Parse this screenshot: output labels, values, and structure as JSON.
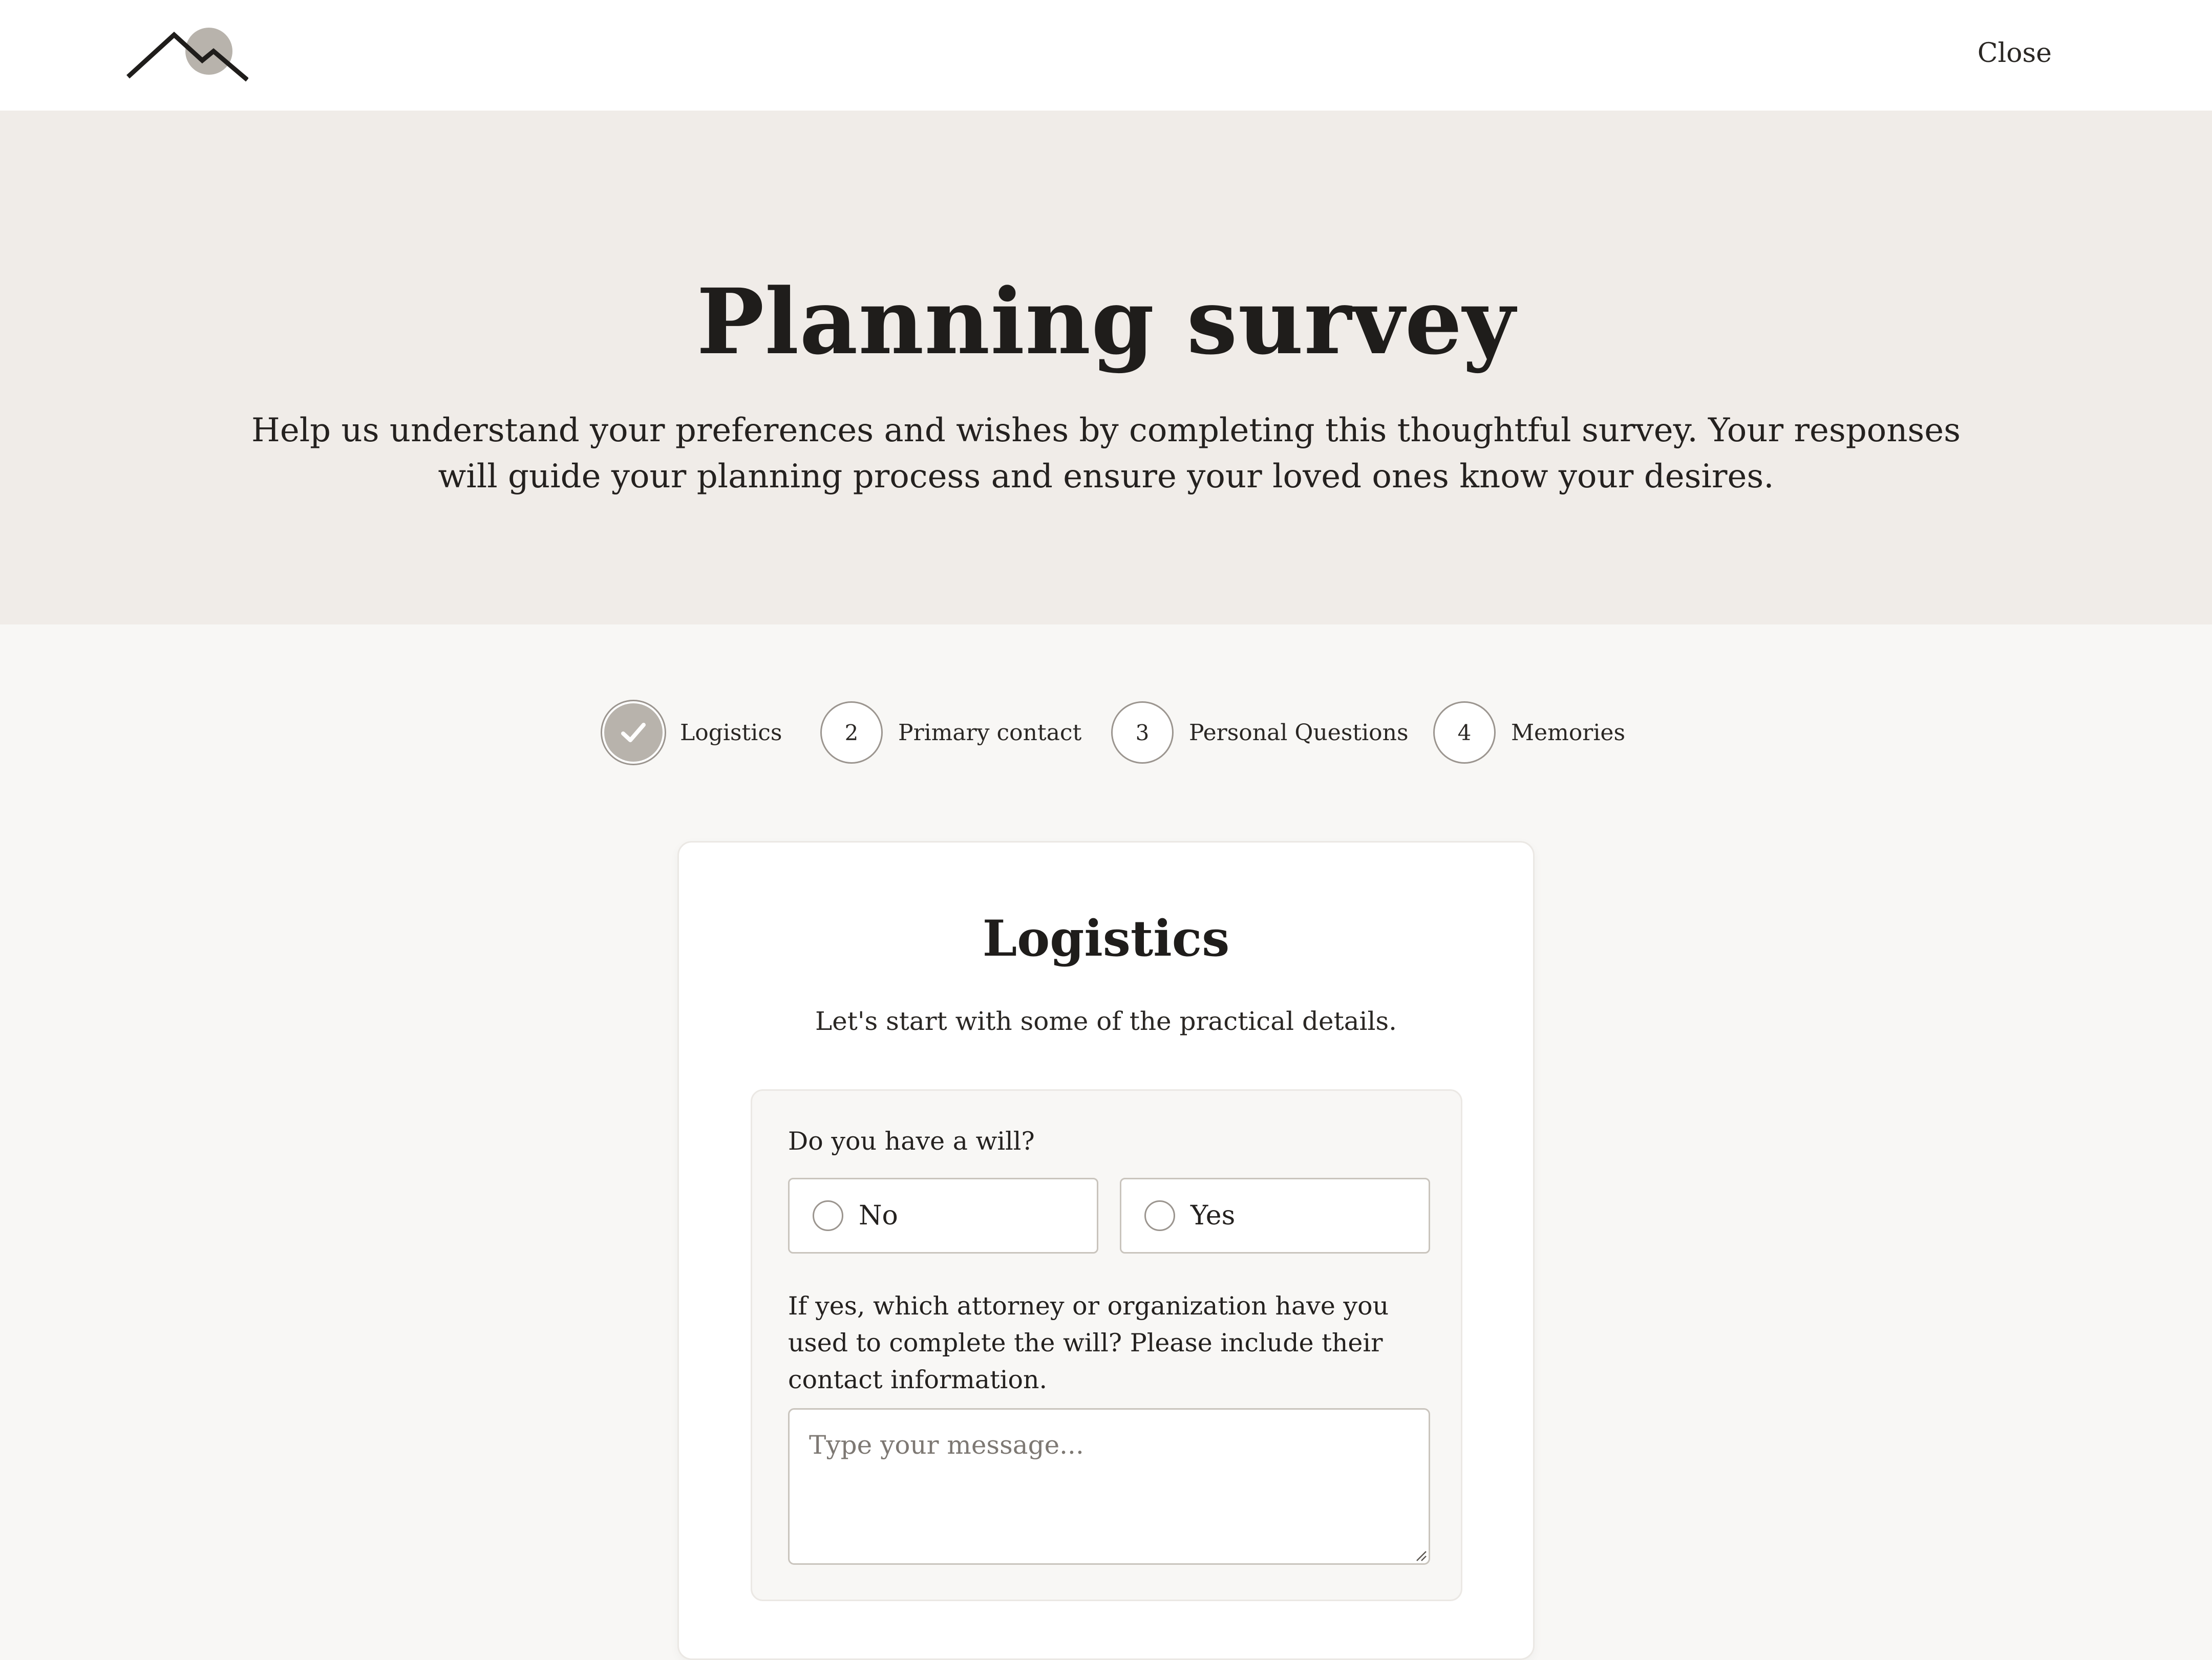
{
  "header": {
    "logo_icon": "mountain-sun-logo-icon",
    "close_label": "Close"
  },
  "hero": {
    "title": "Planning survey",
    "description": "Help us understand your preferences and wishes by completing this thoughtful survey. Your responses will guide your planning process and ensure your loved ones know your desires."
  },
  "stepper": {
    "steps": [
      {
        "number": "",
        "label": "Logistics",
        "status": "completed",
        "icon": "check-icon"
      },
      {
        "number": "2",
        "label": "Primary contact",
        "status": "pending"
      },
      {
        "number": "3",
        "label": "Personal Questions",
        "status": "pending"
      },
      {
        "number": "4",
        "label": "Memories",
        "status": "pending"
      }
    ]
  },
  "card": {
    "title": "Logistics",
    "subtitle": "Let's start with some of the practical details.",
    "questions": [
      {
        "label": "Do you have a will?",
        "type": "radio",
        "options": [
          "No",
          "Yes"
        ],
        "selected": null
      },
      {
        "label": "If yes, which attorney or organization have you used to complete the will? Please include their contact information.",
        "type": "textarea",
        "value": "",
        "placeholder": "Type your message..."
      }
    ]
  },
  "colors": {
    "hero_background": "#f0ece8",
    "page_background": "#f8f7f5",
    "step_completed": "#b8b3ac",
    "text": "#1f1d1b"
  }
}
